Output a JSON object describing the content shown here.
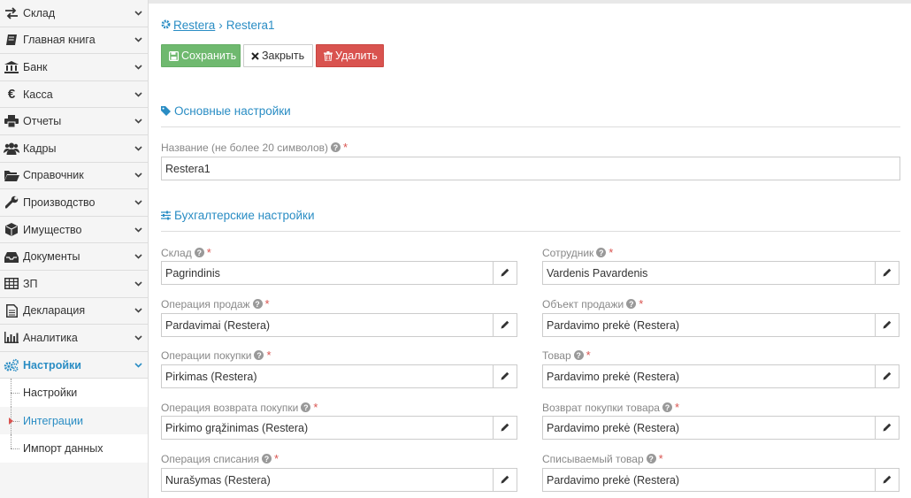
{
  "sidebar": {
    "items": [
      {
        "label": "Склад",
        "icon": "exchange-icon"
      },
      {
        "label": "Главная книга",
        "icon": "book-icon"
      },
      {
        "label": "Банк",
        "icon": "bank-icon"
      },
      {
        "label": "Касса",
        "icon": "euro-icon"
      },
      {
        "label": "Отчеты",
        "icon": "printer-icon"
      },
      {
        "label": "Кадры",
        "icon": "users-icon"
      },
      {
        "label": "Справочник",
        "icon": "folder-open-icon"
      },
      {
        "label": "Производство",
        "icon": "wrench-icon"
      },
      {
        "label": "Имущество",
        "icon": "cube-icon"
      },
      {
        "label": "Документы",
        "icon": "inbox-icon"
      },
      {
        "label": "ЗП",
        "icon": "table-icon"
      },
      {
        "label": "Декларация",
        "icon": "file-text-icon"
      },
      {
        "label": "Аналитика",
        "icon": "bar-chart-icon"
      },
      {
        "label": "Настройки",
        "icon": "gears-icon"
      }
    ],
    "subitems": [
      {
        "label": "Настройки"
      },
      {
        "label": "Интеграции"
      },
      {
        "label": "Импорт данных"
      }
    ]
  },
  "breadcrumb": {
    "root": "Restera",
    "current": "Restera1"
  },
  "toolbar": {
    "save": "Сохранить",
    "close": "Закрыть",
    "delete": "Удалить"
  },
  "sections": {
    "main": "Основные настройки",
    "accounting": "Бухгалтерские настройки"
  },
  "form": {
    "name": {
      "label": "Название (не более 20 символов)",
      "value": "Restera1"
    },
    "warehouse": {
      "label": "Склад",
      "value": "Pagrindinis"
    },
    "employee": {
      "label": "Сотрудник",
      "value": "Vardenis Pavardenis"
    },
    "sales_operation": {
      "label": "Операция продаж",
      "value": "Pardavimai (Restera)"
    },
    "sales_object": {
      "label": "Объект продажи",
      "value": "Pardavimo prekė (Restera)"
    },
    "purchase_operations": {
      "label": "Операции покупки",
      "value": "Pirkimas (Restera)"
    },
    "goods": {
      "label": "Товар",
      "value": "Pardavimo prekė (Restera)"
    },
    "purchase_return_operation": {
      "label": "Операция возврата покупки",
      "value": "Pirkimo grąžinimas (Restera)"
    },
    "purchase_return_goods": {
      "label": "Возврат покупки товара",
      "value": "Pardavimo prekė (Restera)"
    },
    "writeoff_operation": {
      "label": "Операция списания",
      "value": "Nurašymas (Restera)"
    },
    "writeoff_goods": {
      "label": "Списываемый товар",
      "value": "Pardavimo prekė (Restera)"
    }
  },
  "colors": {
    "accent": "#2a8dc4",
    "save": "#6fb96f",
    "delete": "#d9534f",
    "required": "#d9534f"
  }
}
